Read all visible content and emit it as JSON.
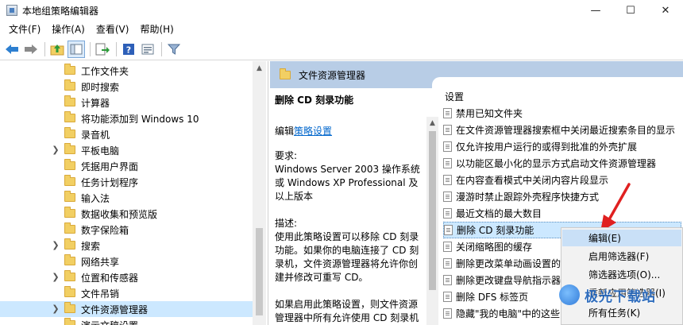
{
  "window": {
    "title": "本地组策略编辑器",
    "controls": {
      "minimize": "—",
      "maximize": "☐",
      "close": "✕"
    }
  },
  "menubar": {
    "items": [
      "文件(F)",
      "操作(A)",
      "查看(V)",
      "帮助(H)"
    ]
  },
  "toolbar": {
    "icons": [
      "back-arrow-icon",
      "forward-arrow-icon",
      "up-folder-icon",
      "show-hide-tree-icon",
      "export-list-icon",
      "help-icon",
      "properties-icon",
      "filter-icon"
    ]
  },
  "tree": {
    "items": [
      {
        "label": "工作文件夹",
        "expandable": false,
        "selected": false
      },
      {
        "label": "即时搜索",
        "expandable": false,
        "selected": false
      },
      {
        "label": "计算器",
        "expandable": false,
        "selected": false
      },
      {
        "label": "将功能添加到 Windows 10",
        "expandable": false,
        "selected": false
      },
      {
        "label": "录音机",
        "expandable": false,
        "selected": false
      },
      {
        "label": "平板电脑",
        "expandable": true,
        "selected": false
      },
      {
        "label": "凭据用户界面",
        "expandable": false,
        "selected": false
      },
      {
        "label": "任务计划程序",
        "expandable": false,
        "selected": false
      },
      {
        "label": "输入法",
        "expandable": false,
        "selected": false
      },
      {
        "label": "数据收集和预览版",
        "expandable": false,
        "selected": false
      },
      {
        "label": "数字保险箱",
        "expandable": false,
        "selected": false
      },
      {
        "label": "搜索",
        "expandable": true,
        "selected": false
      },
      {
        "label": "网络共享",
        "expandable": false,
        "selected": false
      },
      {
        "label": "位置和传感器",
        "expandable": true,
        "selected": false
      },
      {
        "label": "文件吊销",
        "expandable": false,
        "selected": false
      },
      {
        "label": "文件资源管理器",
        "expandable": true,
        "selected": true
      },
      {
        "label": "演示文稿设置",
        "expandable": false,
        "selected": false
      }
    ]
  },
  "right_pane": {
    "header_title": "文件资源管理器",
    "description": {
      "title": "删除 CD 刻录功能",
      "edit_prefix": "编辑",
      "edit_link": "策略设置",
      "requirements_label": "要求:",
      "requirements_lines": [
        "Windows Server 2003 操作系统",
        "或 Windows XP Professional 及",
        "以上版本"
      ],
      "desc_label": "描述:",
      "desc_lines": [
        "使用此策略设置可以移除 CD 刻录",
        "功能。如果你的电脑连接了 CD 刻",
        "录机，文件资源管理器将允许你创",
        "建并修改可重写 CD。"
      ],
      "extra_lines": [
        "如果启用此策略设置，则文件资源",
        "管理器中所有允许使用 CD 刻录机"
      ]
    },
    "settings": {
      "column_header": "设置",
      "items": [
        {
          "label": "禁用已知文件夹",
          "selected": false
        },
        {
          "label": "在文件资源管理器搜索框中关闭最近搜索条目的显示",
          "selected": false
        },
        {
          "label": "仅允许按用户运行的或得到批准的外壳扩展",
          "selected": false
        },
        {
          "label": "以功能区最小化的显示方式启动文件资源管理器",
          "selected": false
        },
        {
          "label": "在内容查看模式中关闭内容片段显示",
          "selected": false
        },
        {
          "label": "漫游时禁止跟踪外壳程序快捷方式",
          "selected": false
        },
        {
          "label": "最近文档的最大数目",
          "selected": false
        },
        {
          "label": "删除 CD 刻录功能",
          "selected": true
        },
        {
          "label": "关闭缩略图的缓存",
          "selected": false
        },
        {
          "label": "删除更改菜单动画设置的",
          "selected": false
        },
        {
          "label": "删除更改键盘导航指示器",
          "selected": false
        },
        {
          "label": "删除 DFS 标签页",
          "selected": false
        },
        {
          "label": "隐藏\"我的电脑\"中的这些",
          "selected": false
        }
      ]
    }
  },
  "context_menu": {
    "items": [
      {
        "label": "编辑(E)",
        "hover": true
      },
      {
        "label": "启用筛选器(F)",
        "hover": false
      },
      {
        "label": "筛选器选项(O)...",
        "hover": false
      },
      {
        "label": "重新应用筛选器(I)",
        "hover": false
      },
      {
        "label": "所有任务(K)",
        "hover": false
      }
    ]
  },
  "annotation": {
    "arrow_color": "#e02020"
  },
  "watermark": {
    "text": "极光下载站",
    "logo": "aurora-logo-icon"
  },
  "colors": {
    "header_bg": "#b8cde6",
    "selection_bg": "#cce8ff",
    "link": "#0066cc",
    "folder": "#f2cf63"
  }
}
